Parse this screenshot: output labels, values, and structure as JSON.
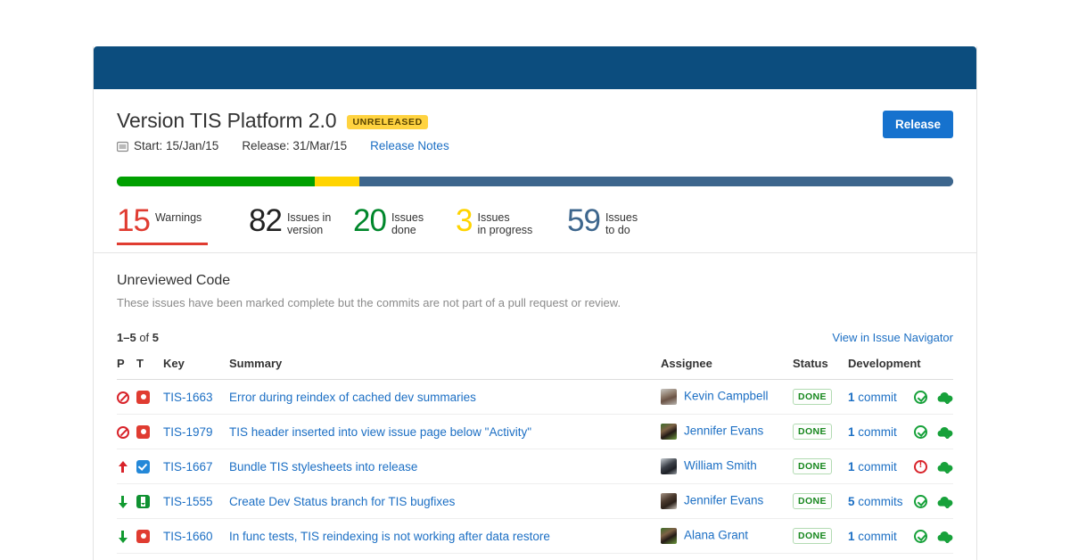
{
  "header": {
    "version_title": "Version TIS Platform 2.0",
    "status_badge": "UNRELEASED",
    "calendar_icon": "calendar-icon",
    "start_label": "Start: 15/Jan/15",
    "release_label": "Release: 31/Mar/15",
    "release_notes_link": "Release Notes",
    "release_button": "Release"
  },
  "progress": {
    "done_pct": 23.7,
    "inprogress_pct": 5.3,
    "todo_pct": 71.0,
    "done_color": "#00a000",
    "inprogress_color": "#ffd400",
    "todo_color": "#3d668d"
  },
  "stats": [
    {
      "num": "15",
      "label": "Warnings",
      "color": "#e03c31",
      "active": true,
      "name": "stat-warnings"
    },
    {
      "num": "82",
      "label": "Issues in\nversion",
      "color": "#222222",
      "active": false,
      "name": "stat-issues-in-version"
    },
    {
      "num": "20",
      "label": "Issues\ndone",
      "color": "#00872b",
      "active": false,
      "name": "stat-issues-done"
    },
    {
      "num": "3",
      "label": "Issues\nin progress",
      "color": "#ffd400",
      "active": false,
      "name": "stat-issues-in-progress"
    },
    {
      "num": "59",
      "label": "Issues\nto do",
      "color": "#3d668d",
      "active": false,
      "name": "stat-issues-to-do"
    }
  ],
  "section": {
    "title": "Unreviewed Code",
    "description": "These issues have been marked complete but the commits are not part of a pull request or review.",
    "range": "1–5",
    "of_word": "of",
    "total": "5",
    "navigator_link": "View in Issue Navigator"
  },
  "table": {
    "columns": [
      "P",
      "T",
      "Key",
      "Summary",
      "Assignee",
      "Status",
      "Development"
    ],
    "rows": [
      {
        "priority_icon": "priority-blocker-icon",
        "type_icon": "issue-type-bug-icon",
        "key": "TIS-1663",
        "summary": "Error during reindex of cached dev summaries",
        "assignee": "Kevin Campbell",
        "avatar": "avatar-kevin-campbell",
        "status": "DONE",
        "development": "1 commit",
        "commit_count": "1",
        "commit_word": "commit",
        "review_icon": "review-ok-icon",
        "deploy_icon": "deploy-ok-icon"
      },
      {
        "priority_icon": "priority-blocker-icon",
        "type_icon": "issue-type-bug-icon",
        "key": "TIS-1979",
        "summary": "TIS header inserted into view issue page below \"Activity\"",
        "assignee": "Jennifer Evans",
        "avatar": "avatar-jennifer-evans",
        "status": "DONE",
        "development": "1 commit",
        "commit_count": "1",
        "commit_word": "commit",
        "review_icon": "review-ok-icon",
        "deploy_icon": "deploy-ok-icon"
      },
      {
        "priority_icon": "priority-major-icon",
        "type_icon": "issue-type-task-icon",
        "key": "TIS-1667",
        "summary": "Bundle TIS stylesheets into release",
        "assignee": "William Smith",
        "avatar": "avatar-william-smith",
        "status": "DONE",
        "development": "1 commit",
        "commit_count": "1",
        "commit_word": "commit",
        "review_icon": "review-warning-icon",
        "deploy_icon": "deploy-ok-icon"
      },
      {
        "priority_icon": "priority-minor-icon",
        "type_icon": "issue-type-story-icon",
        "key": "TIS-1555",
        "summary": "Create Dev Status branch for TIS bugfixes",
        "assignee": "Jennifer Evans",
        "avatar": "avatar-jennifer-evans-2",
        "status": "DONE",
        "development": "5 commits",
        "commit_count": "5",
        "commit_word": "commits",
        "review_icon": "review-ok-icon",
        "deploy_icon": "deploy-ok-icon"
      },
      {
        "priority_icon": "priority-minor-icon",
        "type_icon": "issue-type-bug-icon",
        "key": "TIS-1660",
        "summary": "In func tests, TIS reindexing is not working after data restore",
        "assignee": "Alana Grant",
        "avatar": "avatar-alana-grant",
        "status": "DONE",
        "development": "1 commit",
        "commit_count": "1",
        "commit_word": "commit",
        "review_icon": "review-ok-icon",
        "deploy_icon": "deploy-ok-icon"
      }
    ]
  },
  "colors": {
    "titlebar": "#0c4d7e",
    "link": "#1c6fc4",
    "accent_button": "#1672ce",
    "badge_unreleased_bg": "#ffd340",
    "done_green": "#16871d",
    "warning_red": "#e03c31"
  }
}
